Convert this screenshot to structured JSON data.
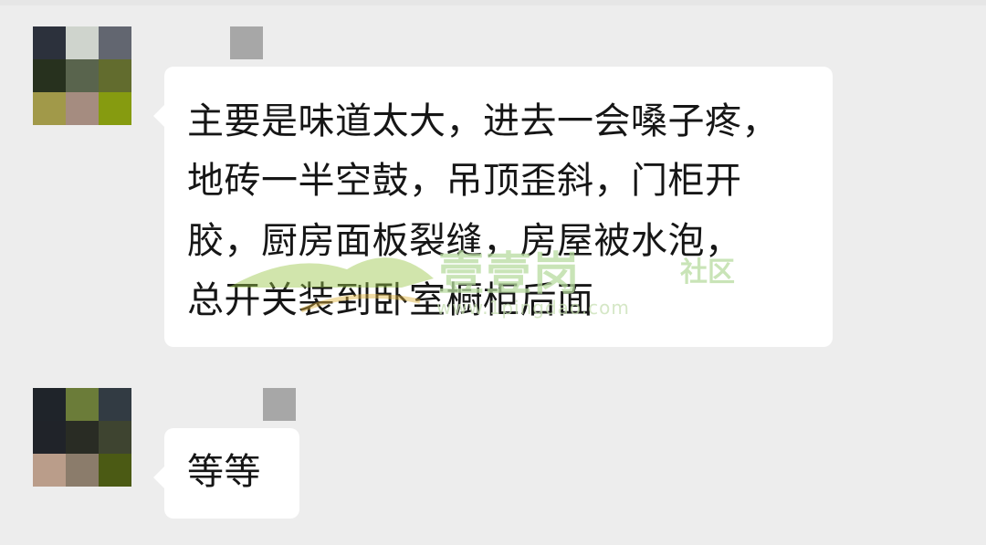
{
  "messages": [
    {
      "lines": [
        "主要是味道太大，进去一会嗓子疼，",
        "地砖一半空鼓，吊顶歪斜，门柜开",
        "胶，厨房面板裂缝，房屋被水泡，",
        "总开关装到卧室橱柜后面"
      ]
    },
    {
      "lines": [
        "等等"
      ]
    }
  ],
  "avatar_colors": [
    [
      "#2c313c",
      "#cfd4cd",
      "#626670",
      "#27311e",
      "#59644d",
      "#626c2e",
      "#a19949",
      "#a58c80",
      "#869b10"
    ],
    [
      "#1f242a",
      "#6b7c39",
      "#323b43",
      "#202329",
      "#292c24",
      "#3e4430",
      "#ba9d8a",
      "#8b7c6b",
      "#4b5a14"
    ]
  ],
  "watermark": {
    "brand": "壹壹岗",
    "tag": "社区",
    "url": "www.1pingdao.com"
  }
}
